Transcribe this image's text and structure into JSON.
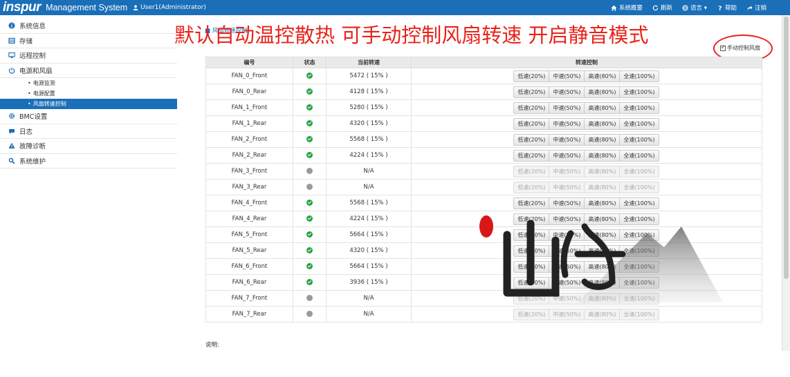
{
  "header": {
    "logo": "inspur",
    "app_name": "Management System",
    "user": "User1(Administrator)",
    "tools": [
      {
        "icon": "home-icon",
        "label": "系统概要"
      },
      {
        "icon": "refresh-icon",
        "label": "刷新"
      },
      {
        "icon": "globe-icon",
        "label": "语言 ▾"
      },
      {
        "icon": "help-icon",
        "label": "帮助"
      },
      {
        "icon": "logout-icon",
        "label": "注销"
      }
    ]
  },
  "sidebar": {
    "items": [
      {
        "icon": "info-icon",
        "label": "系统信息"
      },
      {
        "icon": "storage-icon",
        "label": "存储"
      },
      {
        "icon": "remote-icon",
        "label": "远程控制"
      },
      {
        "icon": "power-icon",
        "label": "电源和风扇"
      },
      {
        "icon": "gear-icon",
        "label": "BMC设置"
      },
      {
        "icon": "log-icon",
        "label": "日志"
      },
      {
        "icon": "warning-icon",
        "label": "故障诊断"
      },
      {
        "icon": "wrench-icon",
        "label": "系统维护"
      }
    ],
    "sub_items": [
      "电源监测",
      "电源配置",
      "风扇转速控制"
    ],
    "active_sub": "风扇转速控制"
  },
  "main": {
    "breadcrumb": "风扇转速控制",
    "banner": "默认自动温控散热 可手动控制风扇转速  开启静音模式",
    "manual_label": "手动控制风扇",
    "manual_checked": true,
    "columns": [
      "编号",
      "状态",
      "当前转速",
      "转速控制"
    ],
    "speed_buttons": [
      "低速(20%)",
      "中速(50%)",
      "高速(80%)",
      "全速(100%)"
    ],
    "note_label": "说明:",
    "rows": [
      {
        "name": "FAN_0_Front",
        "status": "ok",
        "rpm": "5472 ( 15% )",
        "enabled": true
      },
      {
        "name": "FAN_0_Rear",
        "status": "ok",
        "rpm": "4128 ( 15% )",
        "enabled": true
      },
      {
        "name": "FAN_1_Front",
        "status": "ok",
        "rpm": "5280 ( 15% )",
        "enabled": true
      },
      {
        "name": "FAN_1_Rear",
        "status": "ok",
        "rpm": "4320 ( 15% )",
        "enabled": true
      },
      {
        "name": "FAN_2_Front",
        "status": "ok",
        "rpm": "5568 ( 15% )",
        "enabled": true
      },
      {
        "name": "FAN_2_Rear",
        "status": "ok",
        "rpm": "4224 ( 15% )",
        "enabled": true
      },
      {
        "name": "FAN_3_Front",
        "status": "off",
        "rpm": "N/A",
        "enabled": false
      },
      {
        "name": "FAN_3_Rear",
        "status": "off",
        "rpm": "N/A",
        "enabled": false
      },
      {
        "name": "FAN_4_Front",
        "status": "ok",
        "rpm": "5568 ( 15% )",
        "enabled": true
      },
      {
        "name": "FAN_4_Rear",
        "status": "ok",
        "rpm": "4224 ( 15% )",
        "enabled": true
      },
      {
        "name": "FAN_5_Front",
        "status": "ok",
        "rpm": "5664 ( 15% )",
        "enabled": true
      },
      {
        "name": "FAN_5_Rear",
        "status": "ok",
        "rpm": "4320 ( 15% )",
        "enabled": true
      },
      {
        "name": "FAN_6_Front",
        "status": "ok",
        "rpm": "5664 ( 15% )",
        "enabled": true
      },
      {
        "name": "FAN_6_Rear",
        "status": "ok",
        "rpm": "3936 ( 15% )",
        "enabled": true
      },
      {
        "name": "FAN_7_Front",
        "status": "off",
        "rpm": "N/A",
        "enabled": false
      },
      {
        "name": "FAN_7_Rear",
        "status": "off",
        "rpm": "N/A",
        "enabled": false
      }
    ]
  },
  "colors": {
    "brand": "#1a6fb8",
    "banner_red": "#e8231a",
    "status_ok": "#22a447",
    "status_off": "#9a9a9a"
  }
}
